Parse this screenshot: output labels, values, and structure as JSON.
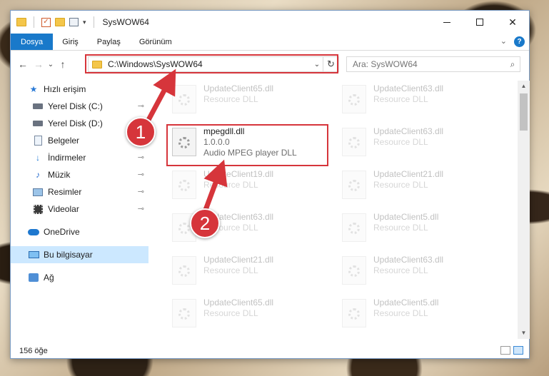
{
  "window": {
    "title": "SysWOW64",
    "minimize": "—",
    "maximize": "",
    "close": "✕"
  },
  "ribbon": {
    "tabs": [
      "Dosya",
      "Giriş",
      "Paylaş",
      "Görünüm"
    ],
    "expand": "⌄",
    "help": "?"
  },
  "nav": {
    "back": "←",
    "forward": "→",
    "recent": "⌄",
    "up": "↑",
    "address": "C:\\Windows\\SysWOW64",
    "address_dropdown": "⌄",
    "refresh": "↻",
    "search_placeholder": "Ara: SysWOW64",
    "search_icon": "⌕"
  },
  "sidebar": {
    "items": [
      {
        "label": "Hızlı erişim",
        "icon": "star-icon",
        "pinned": false
      },
      {
        "label": "Yerel Disk (C:)",
        "icon": "disk-icon",
        "pinned": true
      },
      {
        "label": "Yerel Disk (D:)",
        "icon": "disk-icon",
        "pinned": true
      },
      {
        "label": "Belgeler",
        "icon": "document-icon",
        "pinned": true
      },
      {
        "label": "İndirmeler",
        "icon": "download-icon",
        "pinned": true
      },
      {
        "label": "Müzik",
        "icon": "music-icon",
        "pinned": true
      },
      {
        "label": "Resimler",
        "icon": "pictures-icon",
        "pinned": true
      },
      {
        "label": "Videolar",
        "icon": "videos-icon",
        "pinned": true
      },
      {
        "label": "OneDrive",
        "icon": "onedrive-icon",
        "pinned": false
      },
      {
        "label": "Bu bilgisayar",
        "icon": "this-pc-icon",
        "pinned": false
      },
      {
        "label": "Ağ",
        "icon": "network-icon",
        "pinned": false
      }
    ],
    "pin_glyph": "📌"
  },
  "files": {
    "highlighted": {
      "name": "mpegdll.dll",
      "version": "1.0.0.0",
      "description": "Audio MPEG player DLL"
    },
    "left_column": [
      {
        "name": "UpdateClient65.dll",
        "description": "Resource DLL"
      },
      {
        "name": "UpdateClient19.dll",
        "description": "Resource DLL"
      },
      {
        "name": "UpdateClient63.dll",
        "description": "Resource DLL"
      },
      {
        "name": "UpdateClient21.dll",
        "description": "Resource DLL"
      },
      {
        "name": "UpdateClient65.dll",
        "description": "Resource DLL"
      }
    ],
    "right_column": [
      {
        "name": "UpdateClient63.dll",
        "description": "Resource DLL"
      },
      {
        "name": "UpdateClient63.dll",
        "description": "Resource DLL"
      },
      {
        "name": "UpdateClient21.dll",
        "description": "Resource DLL"
      },
      {
        "name": "UpdateClient5.dll",
        "description": "Resource DLL"
      },
      {
        "name": "UpdateClient63.dll",
        "description": "Resource DLL"
      },
      {
        "name": "UpdateClient5.dll",
        "description": "Resource DLL"
      }
    ]
  },
  "status": {
    "item_count": "156 öğe"
  },
  "annotations": {
    "badge_1": "1",
    "badge_2": "2",
    "accent": "#d6353b"
  }
}
